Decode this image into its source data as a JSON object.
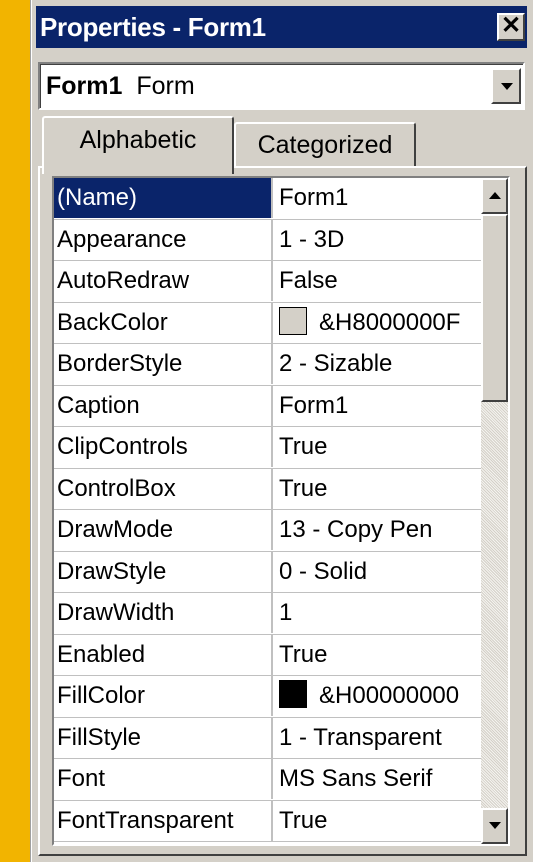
{
  "window": {
    "title": "Properties - Form1",
    "close_glyph": "✕"
  },
  "object_selector": {
    "object_name": "Form1",
    "object_type": "Form"
  },
  "tabs": [
    {
      "label": "Alphabetic",
      "active": true
    },
    {
      "label": "Categorized",
      "active": false
    }
  ],
  "properties": [
    {
      "name": "(Name)",
      "value": "Form1"
    },
    {
      "name": "Appearance",
      "value": "1 - 3D"
    },
    {
      "name": "AutoRedraw",
      "value": "False"
    },
    {
      "name": "BackColor",
      "value": "&H8000000F"
    },
    {
      "name": "BorderStyle",
      "value": "2 - Sizable"
    },
    {
      "name": "Caption",
      "value": "Form1"
    },
    {
      "name": "ClipControls",
      "value": "True"
    },
    {
      "name": "ControlBox",
      "value": "True"
    },
    {
      "name": "DrawMode",
      "value": "13 - Copy Pen"
    },
    {
      "name": "DrawStyle",
      "value": "0 - Solid"
    },
    {
      "name": "DrawWidth",
      "value": "1"
    },
    {
      "name": "Enabled",
      "value": "True"
    },
    {
      "name": "FillColor",
      "value": "&H00000000"
    },
    {
      "name": "FillStyle",
      "value": "1 - Transparent"
    },
    {
      "name": "Font",
      "value": "MS Sans Serif"
    },
    {
      "name": "FontTransparent",
      "value": "True"
    }
  ],
  "swatch_colors": {
    "BackColor": "#d4d0c8",
    "FillColor": "#000000"
  },
  "colors": {
    "titlebar": "#0a246a",
    "selection": "#0a246a",
    "face": "#d4d0c8",
    "desktop": "#f2b400"
  },
  "scrollbar": {
    "up_icon": "scroll-up-arrow-icon",
    "down_icon": "scroll-down-arrow-icon"
  }
}
